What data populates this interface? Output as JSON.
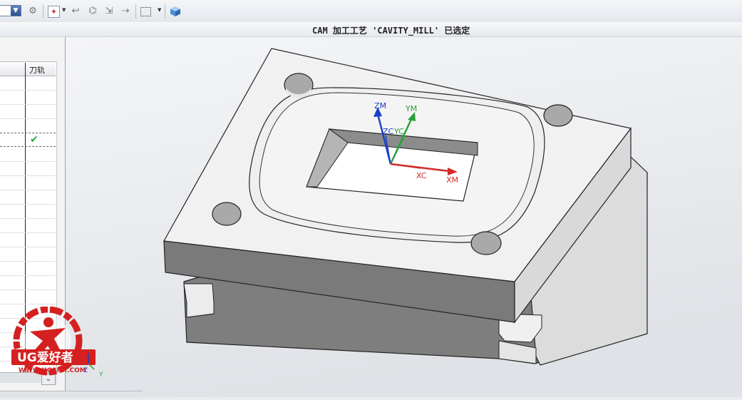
{
  "toolbar": {
    "combo_arrow": "▼",
    "icons": [
      "link-icon",
      "operation-add-icon",
      "undo-icon",
      "display-icon",
      "transform-icon",
      "translate-icon",
      "select-box-icon",
      "cube-view-icon"
    ]
  },
  "status": {
    "text": "CAM 加工工艺 'CAVITY_MILL' 已选定"
  },
  "navigator": {
    "column_header": "刀轨",
    "selected_row_check": "✔",
    "expand_arrow": "⌄"
  },
  "viewport": {
    "axes": {
      "zm": "ZM",
      "ym": "YM",
      "zc": "ZC",
      "yc": "YC",
      "xc": "XC",
      "xm": "XM"
    },
    "mini_triad": {
      "z": "Z",
      "y": "Y"
    }
  },
  "watermark": {
    "line1": "UG爱好者",
    "line2": "WWW.UGSNX.COM"
  },
  "colors": {
    "accent_red": "#d42020",
    "axis_z": "#1d3fc7",
    "axis_y": "#2aa23a",
    "axis_x": "#d42a2a"
  }
}
